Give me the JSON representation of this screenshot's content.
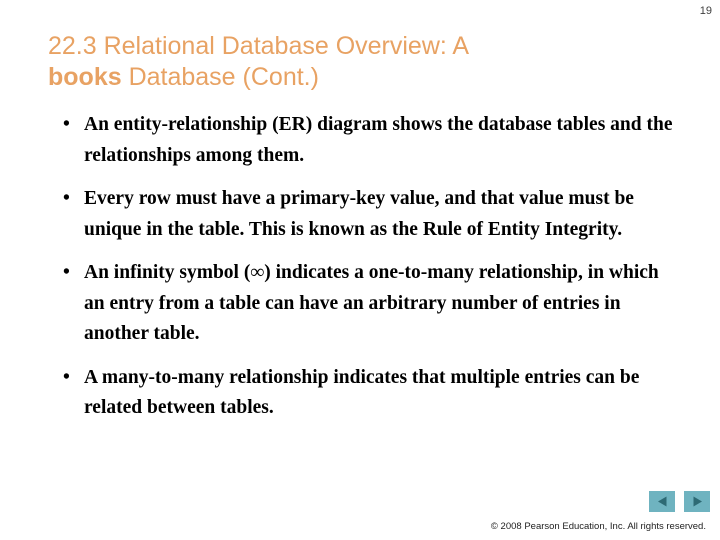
{
  "slide": {
    "page_number": "19",
    "title": {
      "line1_prefix": "22.3 Relational Database Overview: A",
      "mono_term": "books",
      "line2_suffix": " Database (Cont.)",
      "color": "#E8A263"
    },
    "bullets": [
      {
        "marker": "•",
        "text": "An entity-relationship (ER) diagram shows the database tables and the relationships among them."
      },
      {
        "marker": "•",
        "text": "Every row must have a primary-key value, and that value must be unique in the table. This is known as the Rule of Entity Integrity."
      },
      {
        "marker": "•",
        "text": "An infinity symbol (∞) indicates a one-to-many relationship, in which an entry from a table can have an arbitrary number of entries in another table."
      },
      {
        "marker": "•",
        "text": "A many-to-many relationship indicates that multiple entries can be related between tables."
      }
    ],
    "footer": {
      "copyright": "© 2008 Pearson Education, Inc.  All rights reserved."
    },
    "navigation": {
      "back_icon": "triangle-left-icon",
      "forward_icon": "triangle-right-icon",
      "button_color": "#6FB3C0",
      "arrow_color": "#2E6A74"
    }
  }
}
